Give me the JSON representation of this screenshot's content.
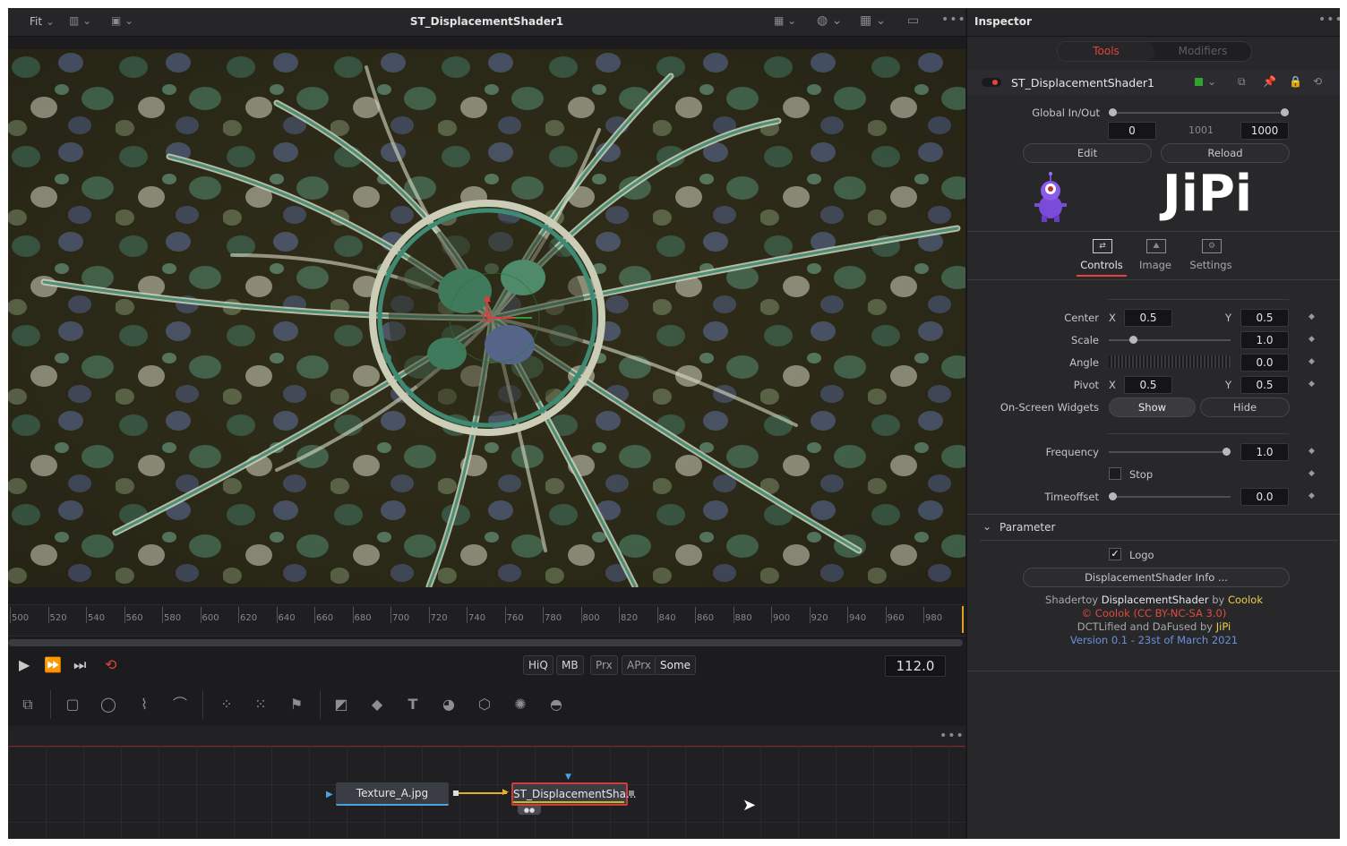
{
  "viewer": {
    "fit_label": "Fit",
    "title": "ST_DisplacementShader1",
    "resolution": "1200x675xint8"
  },
  "timeline": {
    "ticks": [
      "500",
      "520",
      "540",
      "560",
      "580",
      "600",
      "620",
      "640",
      "660",
      "680",
      "700",
      "720",
      "740",
      "760",
      "780",
      "800",
      "820",
      "840",
      "860",
      "880",
      "900",
      "920",
      "940",
      "960",
      "980"
    ]
  },
  "transport": {
    "buttons": [
      "HiQ",
      "MB",
      "Prx",
      "APrx",
      "Some"
    ],
    "current_frame": "112.0"
  },
  "nodes": {
    "input_node": "Texture_A.jpg",
    "shader_node": "ST_DisplacementSha..."
  },
  "inspector": {
    "title": "Inspector",
    "tabs": [
      "Tools",
      "Modifiers"
    ],
    "tool_name": "ST_DisplacementShader1",
    "global_label": "Global In/Out",
    "global_in": "0",
    "global_mid": "1001",
    "global_out": "1000",
    "edit_label": "Edit",
    "reload_label": "Reload",
    "logo_text": "JiPi",
    "subtabs": [
      "Controls",
      "Image",
      "Settings"
    ],
    "center_label": "Center",
    "center_x": "0.5",
    "center_y": "0.5",
    "scale_label": "Scale",
    "scale_value": "1.0",
    "angle_label": "Angle",
    "angle_value": "0.0",
    "pivot_label": "Pivot",
    "pivot_x": "0.5",
    "pivot_y": "0.5",
    "widgets_label": "On-Screen Widgets",
    "show_label": "Show",
    "hide_label": "Hide",
    "frequency_label": "Frequency",
    "frequency_value": "1.0",
    "stop_label": "Stop",
    "timeoffset_label": "Timeoffset",
    "timeoffset_value": "0.0",
    "x_label": "X",
    "y_label": "Y",
    "parameter_label": "Parameter",
    "logo_check_label": "Logo",
    "info_button": "DisplacementShader Info ...",
    "credit_1a": "Shadertoy ",
    "credit_1b": "DisplacementShader",
    "credit_1c": " by ",
    "credit_1d": "Coolok",
    "credit_2": "© Coolok (CC BY-NC-SA 3.0)",
    "credit_3a": "DCTLified and DaFused by ",
    "credit_3b": "JiPi",
    "credit_4": "Version 0.1 - 23st of March 2021"
  },
  "colors": {
    "accent_red": "#e0443c",
    "credit_yellow": "#e8d04a",
    "credit_red": "#e24a3a",
    "credit_blue": "#6b8fe0",
    "node_green": "#2fa52f"
  }
}
